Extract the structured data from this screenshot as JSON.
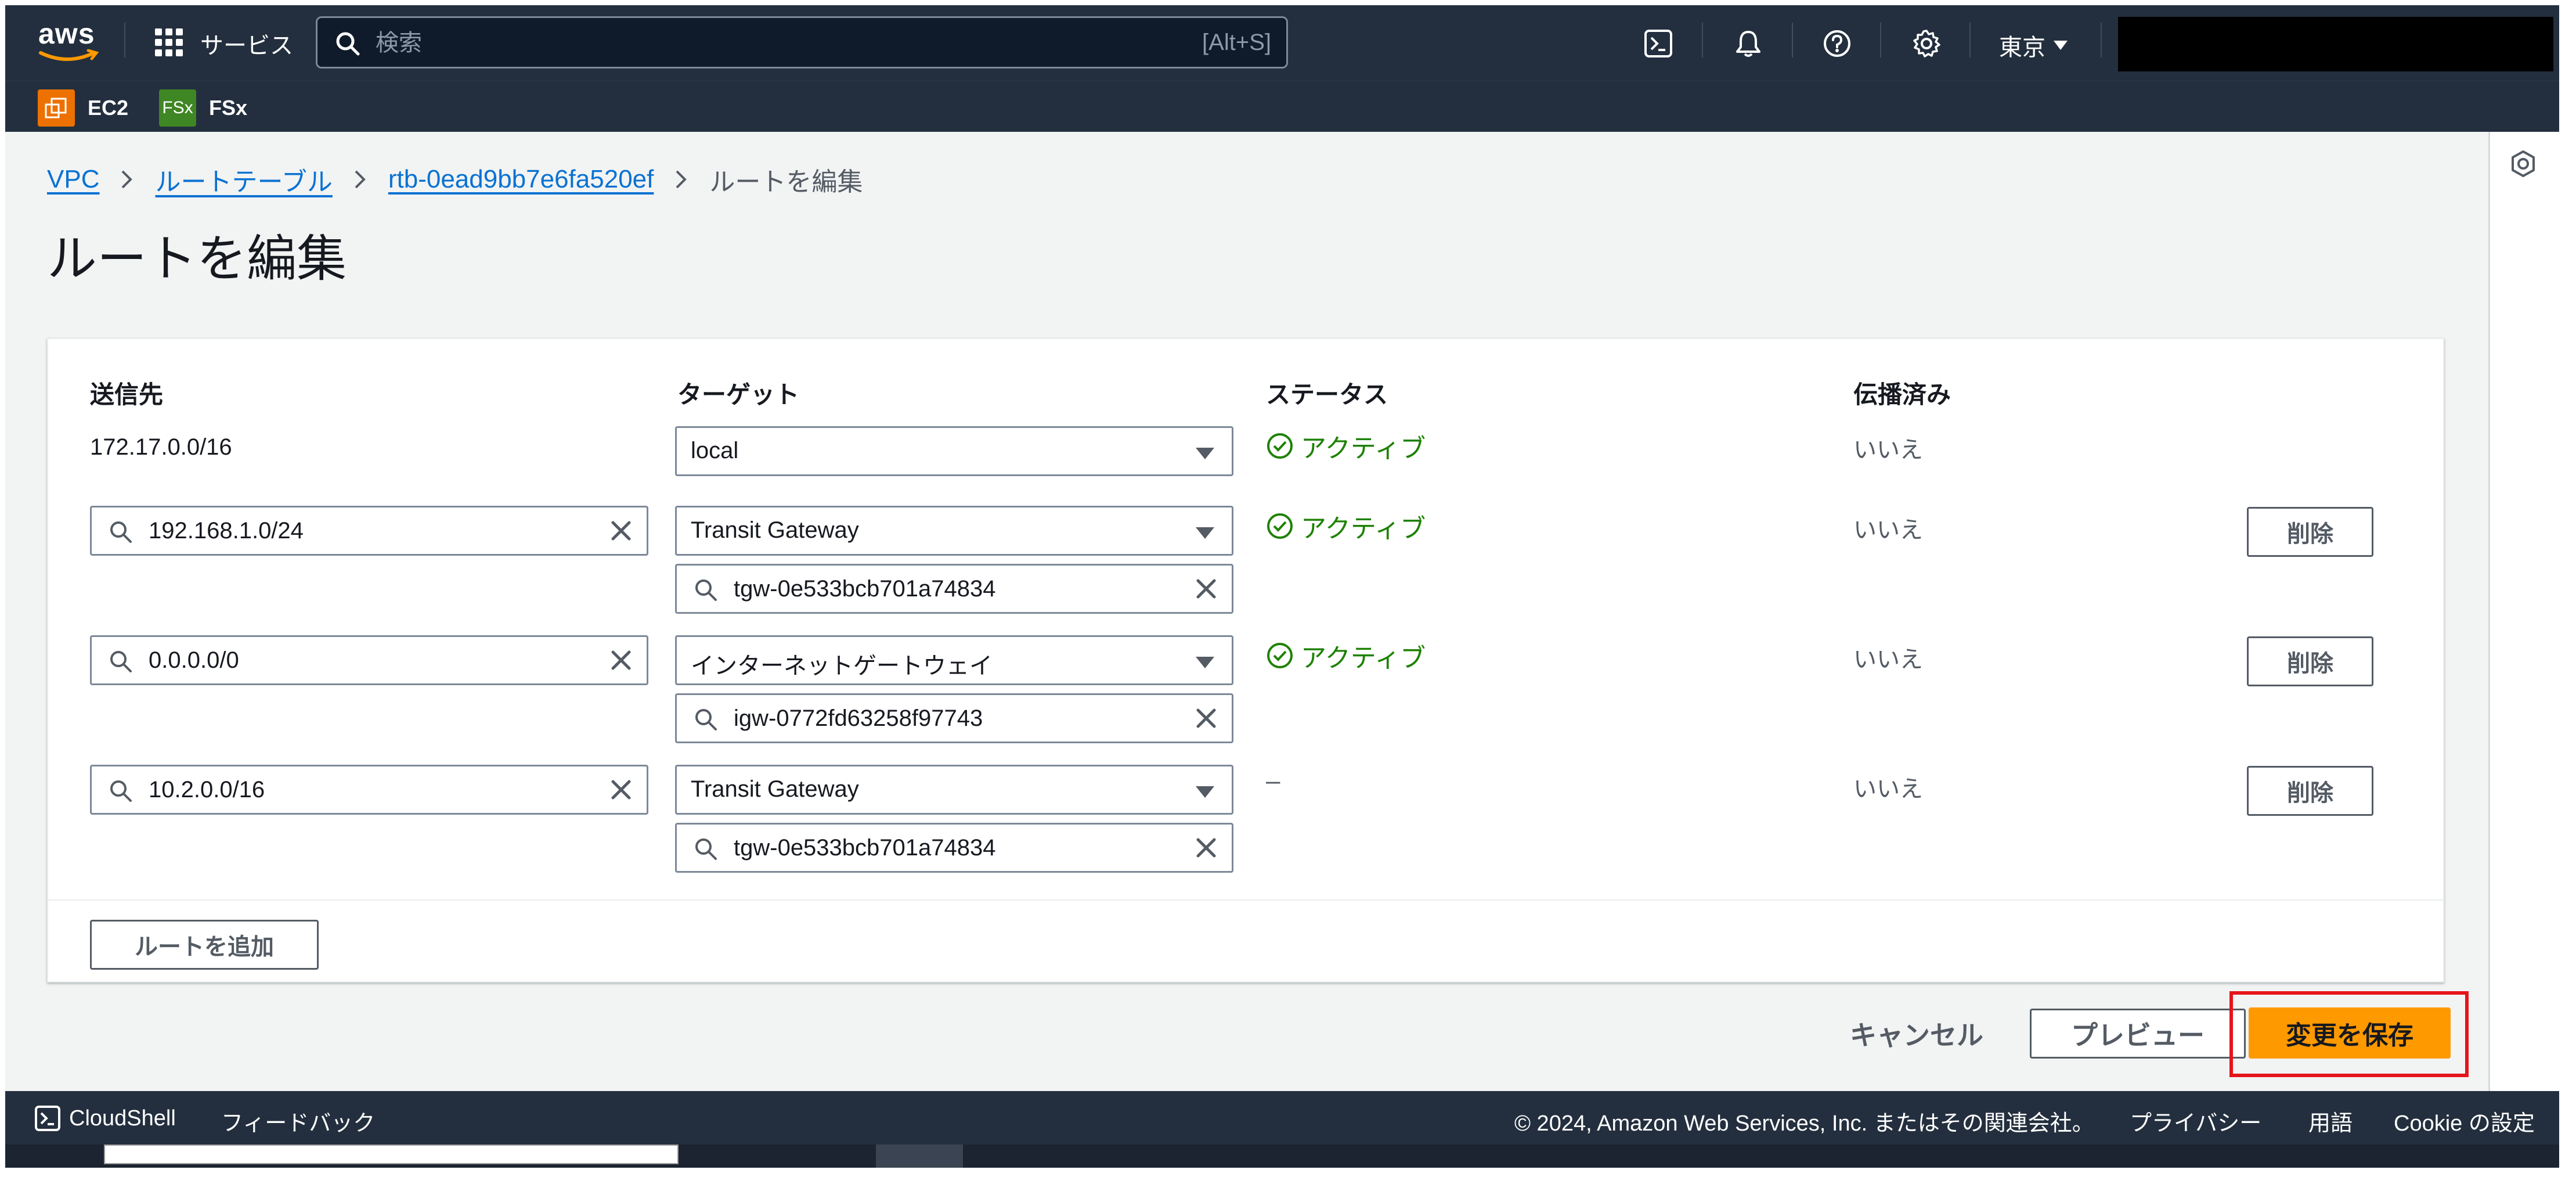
{
  "topnav": {
    "logo_text": "aws",
    "services_label": "サービス",
    "search_placeholder": "検索",
    "search_shortcut": "[Alt+S]",
    "region_label": "東京",
    "icons": [
      "cloudshell-icon",
      "bell-icon",
      "help-icon",
      "gear-icon"
    ]
  },
  "favorites": [
    {
      "label": "EC2",
      "icon": "ec2-icon",
      "color": "#ed7100"
    },
    {
      "label": "FSx",
      "icon_text": "FSx",
      "icon": "fsx-icon",
      "color": "#3f8624"
    }
  ],
  "breadcrumb": {
    "items": [
      "VPC",
      "ルートテーブル",
      "rtb-0ead9bb7e6fa520ef"
    ],
    "current": "ルートを編集"
  },
  "page_title": "ルートを編集",
  "routes_table": {
    "headers": {
      "destination": "送信先",
      "target": "ターゲット",
      "status": "ステータス",
      "propagated": "伝播済み"
    },
    "rows": [
      {
        "destination": "172.17.0.0/16",
        "target_type": "local",
        "target_id": "",
        "status": "アクティブ",
        "propagated": "いいえ"
      },
      {
        "destination": "192.168.1.0/24",
        "target_type": "Transit Gateway",
        "target_id": "tgw-0e533bcb701a74834",
        "status": "アクティブ",
        "propagated": "いいえ",
        "delete_label": "削除"
      },
      {
        "destination": "0.0.0.0/0",
        "target_type": "インターネットゲートウェイ",
        "target_id": "igw-0772fd63258f97743",
        "status": "アクティブ",
        "propagated": "いいえ",
        "delete_label": "削除"
      },
      {
        "destination": "10.2.0.0/16",
        "target_type": "Transit Gateway",
        "target_id": "tgw-0e533bcb701a74834",
        "status": "–",
        "propagated": "いいえ",
        "delete_label": "削除"
      }
    ],
    "add_route_label": "ルートを追加"
  },
  "actions": {
    "cancel_label": "キャンセル",
    "preview_label": "プレビュー",
    "save_label": "変更を保存"
  },
  "footer": {
    "cloudshell_label": "CloudShell",
    "feedback_label": "フィードバック",
    "copyright": "© 2024, Amazon Web Services, Inc. またはその関連会社。",
    "privacy_label": "プライバシー",
    "terms_label": "用語",
    "cookie_label": "Cookie の設定"
  },
  "colors": {
    "nav_bg": "#232f3e",
    "link": "#0972d3",
    "status_active": "#1d8102",
    "primary_button": "#ff9900",
    "highlight_frame": "#e5141b"
  }
}
